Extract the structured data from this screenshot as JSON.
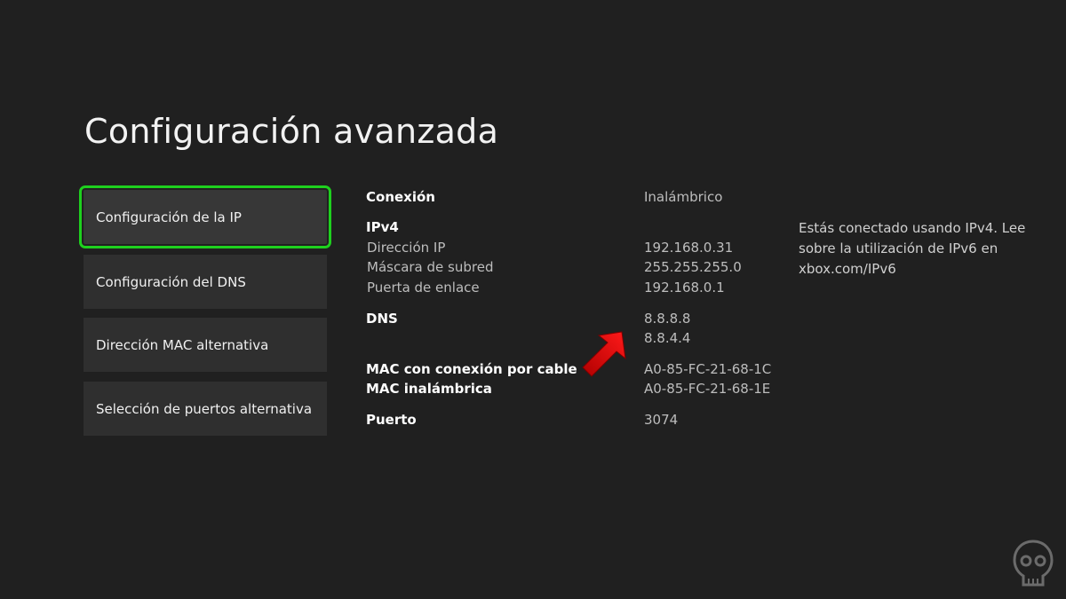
{
  "page_title": "Configuración avanzada",
  "menu": [
    {
      "label": "Configuración de la IP",
      "selected": true
    },
    {
      "label": "Configuración del DNS",
      "selected": false
    },
    {
      "label": "Dirección MAC alternativa",
      "selected": false
    },
    {
      "label": "Selección de puertos alternativa",
      "selected": false
    }
  ],
  "details": {
    "connection_label": "Conexión",
    "connection_value": "Inalámbrico",
    "ipv4_heading": "IPv4",
    "ip_label": "Dirección IP",
    "ip_value": "192.168.0.31",
    "mask_label": "Máscara de subred",
    "mask_value": "255.255.255.0",
    "gateway_label": "Puerta de enlace",
    "gateway_value": "192.168.0.1",
    "dns_label": "DNS",
    "dns_primary": "8.8.8.8",
    "dns_secondary": "8.8.4.4",
    "mac_wired_label": "MAC con conexión por cable",
    "mac_wired_value": "A0-85-FC-21-68-1C",
    "mac_wireless_label": "MAC inalámbrica",
    "mac_wireless_value": "A0-85-FC-21-68-1E",
    "port_label": "Puerto",
    "port_value": "3074"
  },
  "note": "Estás conectado usando IPv4. Lee sobre la utilización de IPv6 en xbox.com/IPv6",
  "colors": {
    "background": "#202020",
    "menu_item": "#2f2f2f",
    "focus_outline": "#1ed01e",
    "annotation_arrow": "#e00000"
  },
  "icons": {
    "annotation": "red-arrow-icon",
    "watermark": "watermark-logo-icon"
  }
}
